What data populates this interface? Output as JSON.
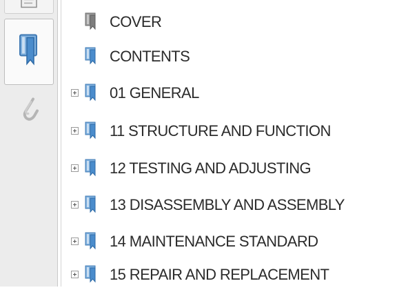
{
  "rail": {
    "buttons": [
      {
        "name": "page-thumbnails-icon",
        "active": false
      },
      {
        "name": "bookmarks-icon",
        "active": true
      },
      {
        "name": "attachments-icon",
        "active": false
      }
    ]
  },
  "bookmarks": {
    "items": [
      {
        "label": "COVER",
        "expandable": false,
        "icon": "bookmark-page-icon"
      },
      {
        "label": "CONTENTS",
        "expandable": false,
        "icon": "bookmark-page-icon"
      },
      {
        "label": "01 GENERAL",
        "expandable": true,
        "icon": "bookmark-page-icon"
      },
      {
        "label": "11 STRUCTURE AND FUNCTION",
        "expandable": true,
        "icon": "bookmark-page-icon"
      },
      {
        "label": "12 TESTING AND ADJUSTING",
        "expandable": true,
        "icon": "bookmark-page-icon"
      },
      {
        "label": "13 DISASSEMBLY AND ASSEMBLY",
        "expandable": true,
        "icon": "bookmark-page-icon"
      },
      {
        "label": "14 MAINTENANCE STANDARD",
        "expandable": true,
        "icon": "bookmark-page-icon"
      },
      {
        "label": "15 REPAIR AND REPLACEMENT",
        "expandable": true,
        "icon": "bookmark-page-icon"
      }
    ]
  },
  "colors": {
    "bookmark_icon_blue": "#5b9bd5",
    "bookmark_icon_gray": "#8a8a8a",
    "text": "#2b2b2b"
  }
}
